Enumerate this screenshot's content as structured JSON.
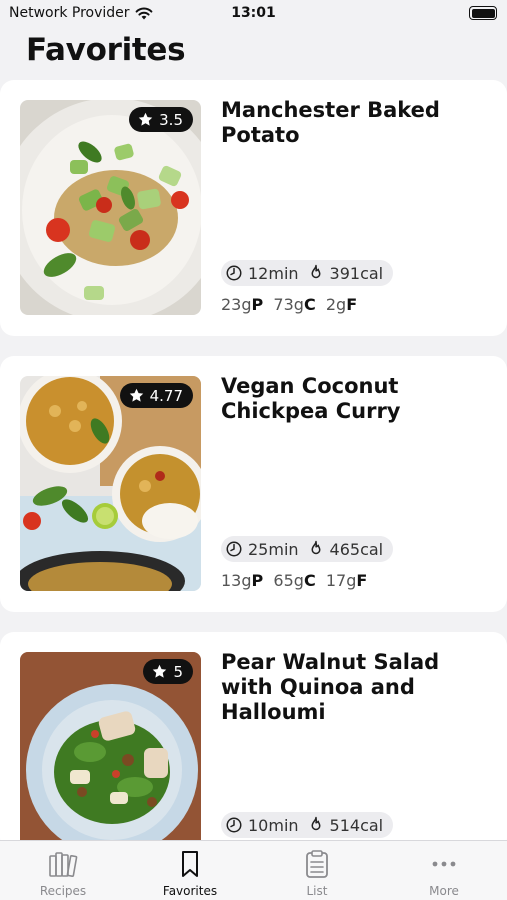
{
  "status": {
    "carrier": "Network Provider",
    "time": "13:01"
  },
  "page": {
    "title": "Favorites"
  },
  "recipes": [
    {
      "title": "Manchester Baked Potato",
      "rating": "3.5",
      "time": "12min",
      "calories": "391cal",
      "protein": "23g",
      "carbs": "73g",
      "fat": "2g",
      "protein_unit": "P",
      "carbs_unit": "C",
      "fat_unit": "F"
    },
    {
      "title": "Vegan Coconut Chickpea Curry",
      "rating": "4.77",
      "time": "25min",
      "calories": "465cal",
      "protein": "13g",
      "carbs": "65g",
      "fat": "17g",
      "protein_unit": "P",
      "carbs_unit": "C",
      "fat_unit": "F"
    },
    {
      "title": "Pear Walnut Salad with Quinoa and Halloumi",
      "rating": "5",
      "time": "10min",
      "calories": "514cal"
    }
  ],
  "tabs": [
    {
      "label": "Recipes",
      "icon": "recipes-book-icon",
      "active": false
    },
    {
      "label": "Favorites",
      "icon": "bookmark-icon",
      "active": true
    },
    {
      "label": "List",
      "icon": "clipboard-list-icon",
      "active": false
    },
    {
      "label": "More",
      "icon": "more-dots-icon",
      "active": false
    }
  ]
}
